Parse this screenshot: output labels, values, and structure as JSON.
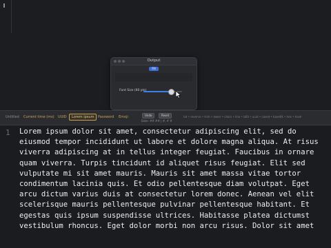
{
  "top": {
    "caret": "›"
  },
  "dialog": {
    "title": "Output",
    "chip": "Fill",
    "slider": {
      "label": "Font Size (60 pts)",
      "level": 0.72
    }
  },
  "toolbar": {
    "items": [
      {
        "label": "Untitled",
        "style": "dim"
      },
      {
        "label": "Current time (ms)",
        "style": "normal"
      },
      {
        "label": "UUID",
        "style": "normal"
      },
      {
        "label": "Lorem ipsum",
        "style": "active"
      },
      {
        "label": "Password",
        "style": "normal"
      },
      {
        "label": "Emoji",
        "style": "normal"
      }
    ],
    "buttons": {
      "undo": "Undo",
      "reset": "Reset"
    },
    "meta": "Date: ##.## | #, # #",
    "pipeline": "txt • reverse • trim • lower • chars • line • b64 • uuid • cased • base64 • hex • hash"
  },
  "editor": {
    "line_number": "1",
    "text": "Lorem ipsum dolor sit amet, consectetur adipiscing elit, sed do eiusmod tempor incididunt ut labore et dolore magna aliqua. At risus viverra adipiscing at in tellus integer feugiat. Faucibus in ornare quam viverra. Turpis tincidunt id aliquet risus feugiat. Elit sed vulputate mi sit amet mauris. Mauris sit amet massa vitae tortor condimentum lacinia quis. Et odio pellentesque diam volutpat. Eget arcu dictum varius duis at consectetur lorem donec. Aenean vel elit scelerisque mauris pellentesque pulvinar pellentesque habitant. Et egestas quis ipsum suspendisse ultrices. Habitasse platea dictumst vestibulum rhoncus. Eget dolor morbi non arcu risus. Dolor sit amet"
  }
}
